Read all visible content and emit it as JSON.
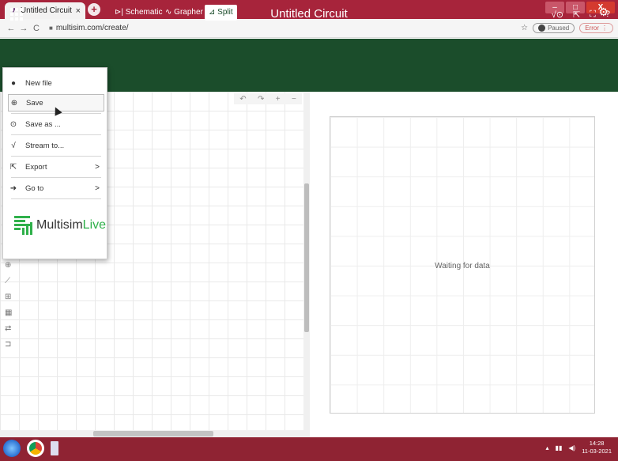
{
  "browser": {
    "tab_title": "Untitled Circuit",
    "tab_close": "×",
    "new_tab": "+",
    "url": "multisim.com/create/",
    "paused_label": "Paused",
    "error_label": "Error",
    "window_minimize": "–",
    "window_maximize": "□",
    "window_close": "X"
  },
  "app": {
    "title": "Untitled Circuit",
    "header_icons": [
      "stream-icon",
      "export-icon",
      "fullscreen-icon",
      "help-icon"
    ],
    "help_glyph": "?",
    "accent_color": "#1b4d2b"
  },
  "toolbar": {
    "schematic_label": "Schematic",
    "grapher_label": "Grapher",
    "split_label": "Split",
    "active_tab": "Split"
  },
  "menu": {
    "items": [
      {
        "label": "New file",
        "icon": "new-file-icon"
      },
      {
        "label": "Save",
        "icon": "save-icon"
      },
      {
        "label": "Save as ...",
        "icon": "save-as-icon"
      },
      {
        "label": "Stream to...",
        "icon": "stream-icon"
      },
      {
        "label": "Export",
        "icon": "export-icon",
        "submenu": true
      },
      {
        "label": "Go to",
        "icon": "goto-icon",
        "submenu": true
      }
    ],
    "submenu_arrow": ">",
    "hovered_item": "Save",
    "logo": {
      "text_main": "Multisim",
      "text_accent": "Live"
    }
  },
  "schematic": {
    "controls": [
      "undo-icon",
      "redo-icon",
      "zoom-in-icon",
      "zoom-out-icon"
    ],
    "zoom_in": "+",
    "zoom_out": "−",
    "side_tools": [
      "probe-icon",
      "wire-icon",
      "component-icon",
      "ic-icon",
      "switch-icon",
      "gate-icon"
    ]
  },
  "grapher": {
    "status": "Waiting for data"
  },
  "taskbar": {
    "time": "14:28",
    "date": "11-03-2021"
  }
}
